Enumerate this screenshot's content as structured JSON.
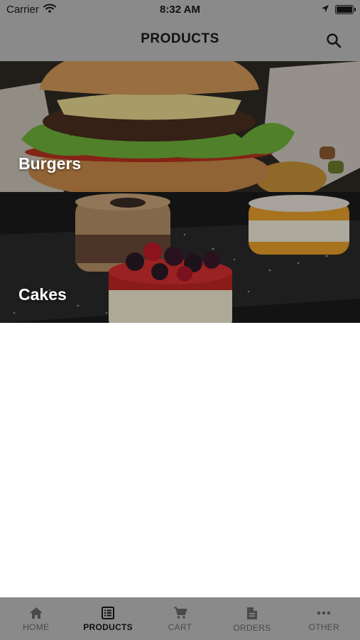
{
  "status_bar": {
    "carrier": "Carrier",
    "time": "8:32 AM",
    "icons": [
      "wifi-icon",
      "location-arrow-icon",
      "battery-icon"
    ]
  },
  "header": {
    "title": "PRODUCTS",
    "search_icon": "search-icon"
  },
  "categories": [
    {
      "label": "Burgers",
      "image": "burger-photo"
    },
    {
      "label": "Cakes",
      "image": "cakes-photo"
    }
  ],
  "tab_bar": {
    "active": "PRODUCTS",
    "tabs": [
      {
        "label": "HOME",
        "icon": "home-icon"
      },
      {
        "label": "PRODUCTS",
        "icon": "list-icon"
      },
      {
        "label": "CART",
        "icon": "cart-icon"
      },
      {
        "label": "ORDERS",
        "icon": "document-icon"
      },
      {
        "label": "OTHER",
        "icon": "more-dots-icon"
      }
    ]
  }
}
